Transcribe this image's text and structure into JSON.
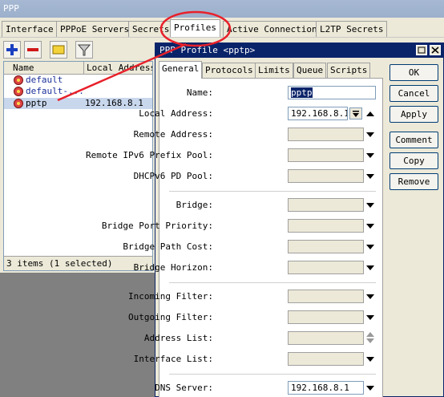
{
  "ppp": {
    "title": "PPP",
    "tabs": [
      "Interface",
      "PPPoE Servers",
      "Secrets",
      "Profiles",
      "Active Connections",
      "L2TP Secrets"
    ],
    "columns": [
      "Name",
      "Local Address"
    ],
    "rows": [
      {
        "name": "default",
        "address": ""
      },
      {
        "name": "default-...",
        "address": ""
      },
      {
        "name": "pptp",
        "address": "192.168.8.1"
      }
    ],
    "status": "3 items (1 selected)"
  },
  "dialog": {
    "title": "PPP Profile <pptp>",
    "tabs": [
      "General",
      "Protocols",
      "Limits",
      "Queue",
      "Scripts"
    ],
    "labels": {
      "name": "Name:",
      "local_address": "Local Address:",
      "remote_address": "Remote Address:",
      "remote_ipv6_pool": "Remote IPv6 Prefix Pool:",
      "dhcpv6_pd_pool": "DHCPv6 PD Pool:",
      "bridge": "Bridge:",
      "bridge_port_priority": "Bridge Port Priority:",
      "bridge_path_cost": "Bridge Path Cost:",
      "bridge_horizon": "Bridge Horizon:",
      "incoming_filter": "Incoming Filter:",
      "outgoing_filter": "Outgoing Filter:",
      "address_list": "Address List:",
      "interface_list": "Interface List:",
      "dns_server": "DNS Server:"
    },
    "values": {
      "name": "pptp",
      "local_address": "192.168.8.1",
      "dns_server": "192.168.8.1"
    },
    "buttons": [
      "OK",
      "Cancel",
      "Apply",
      "Comment",
      "Copy",
      "Remove"
    ]
  },
  "colors": {
    "annotation": "#e8202a",
    "dialog_titlebar": "#0a246a",
    "selection": "#c9d7ed"
  }
}
